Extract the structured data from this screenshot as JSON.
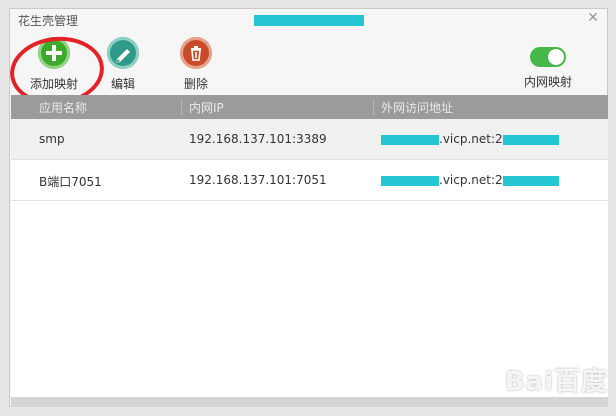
{
  "window": {
    "title": "花生壳管理"
  },
  "toolbar": {
    "add_label": "添加映射",
    "edit_label": "编辑",
    "delete_label": "删除",
    "toggle_label": "内网映射",
    "toggle_on": true
  },
  "table": {
    "headers": [
      "应用名称",
      "内网IP",
      "外网访问地址"
    ],
    "rows": [
      {
        "name": "smp",
        "ip": "192.168.137.101:3389",
        "ext": ".vicp.net:2"
      },
      {
        "name": "B端口7051",
        "ip": "192.168.137.101:7051",
        "ext": ".vicp.net:2"
      }
    ]
  },
  "watermark": "Bai百度",
  "colors": {
    "accent_green": "#3eaa2b",
    "redaction": "#25c6d2",
    "highlight": "#e32227",
    "header_bg": "#9b9b9b"
  }
}
